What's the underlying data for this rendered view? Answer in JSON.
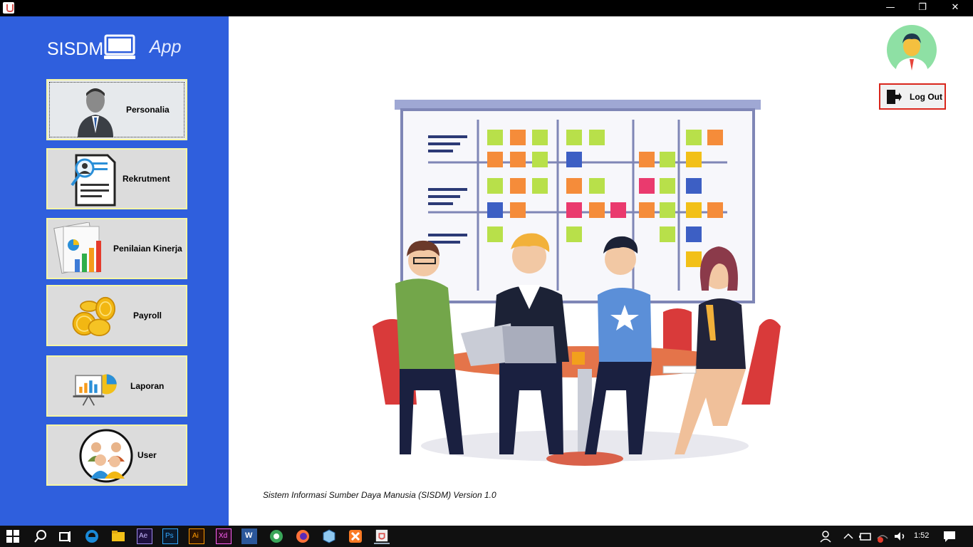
{
  "window": {
    "minimize_glyph": "—",
    "maximize_glyph": "❐",
    "close_glyph": "✕"
  },
  "sidebar": {
    "logo_text": "SISDM",
    "logo_app": "App",
    "items": [
      {
        "label": "Personalia",
        "icon": "businessman-icon"
      },
      {
        "label": "Rekrutment",
        "icon": "resume-search-icon"
      },
      {
        "label": "Penilaian Kinerja",
        "icon": "bar-chart-report-icon"
      },
      {
        "label": "Payroll",
        "icon": "gold-coins-icon"
      },
      {
        "label": "Laporan",
        "icon": "presentation-board-icon"
      },
      {
        "label": "User",
        "icon": "user-group-icon"
      }
    ],
    "colors": {
      "background": "#2f5fdd",
      "button": "#dcdcdc",
      "button_border": "#f6f6a6"
    }
  },
  "header": {
    "logout_label": "Log Out"
  },
  "main": {
    "version_text": "Sistem Informasi Sumber Daya Manusia (SISDM) Version 1.0",
    "illustration": "team-meeting-illustration"
  },
  "taskbar": {
    "apps": [
      "windows-start-icon",
      "search-icon",
      "task-view-icon",
      "edge-icon",
      "file-explorer-icon",
      "after-effects-icon",
      "photoshop-icon",
      "illustrator-icon",
      "xd-icon",
      "word-icon",
      "app-icon",
      "firefox-icon",
      "virtualbox-icon",
      "xampp-icon",
      "java-icon"
    ],
    "app_labels": {
      "ae": "Ae",
      "ps": "Ps",
      "ai": "Ai",
      "xd": "Xd",
      "w": "W"
    },
    "time": "1:52"
  }
}
